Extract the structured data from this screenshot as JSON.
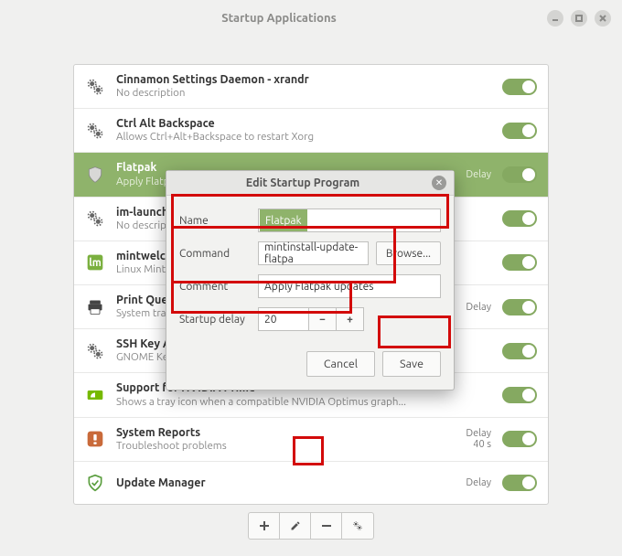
{
  "window": {
    "title": "Startup Applications"
  },
  "items": [
    {
      "name": "Cinnamon Settings Daemon - xrandr",
      "desc": "No description",
      "delay": ""
    },
    {
      "name": "Ctrl Alt Backspace",
      "desc": "Allows Ctrl+Alt+Backspace to restart Xorg",
      "delay": ""
    },
    {
      "name": "Flatpak",
      "desc": "Apply Flatpak updates",
      "delay": "Delay"
    },
    {
      "name": "im-launch",
      "desc": "No description",
      "delay": ""
    },
    {
      "name": "mintwelcome",
      "desc": "Linux Mint",
      "delay": ""
    },
    {
      "name": "Print Queue Applet",
      "desc": "System tray",
      "delay": "Delay"
    },
    {
      "name": "SSH Key Agent",
      "desc": "GNOME Keyring",
      "delay": ""
    },
    {
      "name": "Support for NVIDIA Prime",
      "desc": "Shows a tray icon when a compatible NVIDIA Optimus graph...",
      "delay": ""
    },
    {
      "name": "System Reports",
      "desc": "Troubleshoot problems",
      "delay": "Delay\n40 s"
    },
    {
      "name": "Update Manager",
      "desc": "",
      "delay": "Delay"
    }
  ],
  "dialog": {
    "title": "Edit Startup Program",
    "name_label": "Name",
    "name_value": "Flatpak",
    "command_label": "Command",
    "command_value": "mintinstall-update-flatpa",
    "browse": "Browse...",
    "comment_label": "Comment",
    "comment_value": "Apply Flatpak updates",
    "delay_label": "Startup delay",
    "delay_value": "20",
    "cancel": "Cancel",
    "save": "Save"
  }
}
